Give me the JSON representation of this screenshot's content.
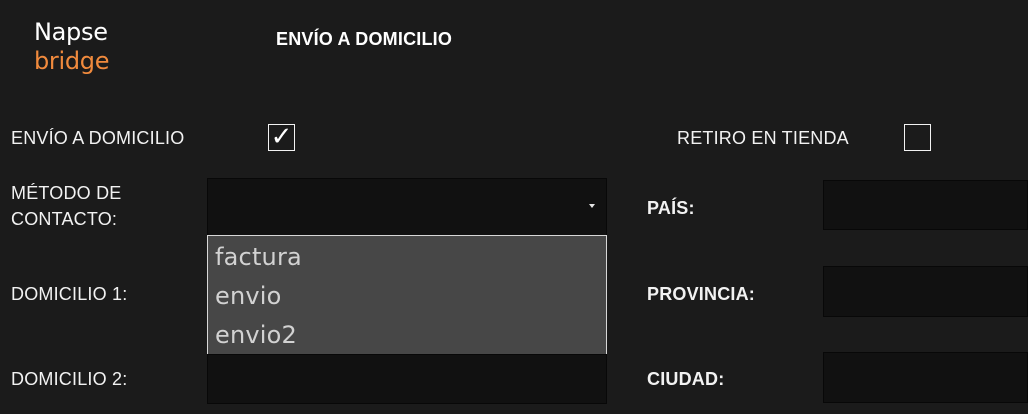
{
  "logo": {
    "line1": "Napse",
    "line2": "bridge"
  },
  "header": {
    "title": "ENVÍO A DOMICILIO"
  },
  "form": {
    "envio_domicilio": {
      "label": "ENVÍO A DOMICILIO",
      "checked": true,
      "mark": "✓"
    },
    "retiro_tienda": {
      "label": "RETIRO EN TIENDA",
      "checked": false
    },
    "metodo_contacto": {
      "label_line1": "MÉTODO DE",
      "label_line2": "CONTACTO:",
      "value": "",
      "options": [
        "factura",
        "envio",
        "envio2"
      ]
    },
    "domicilio1": {
      "label": "DOMICILIO 1:",
      "value": ""
    },
    "domicilio2": {
      "label": "DOMICILIO 2:",
      "value": ""
    },
    "pais": {
      "label": "PAÍS:",
      "value": ""
    },
    "provincia": {
      "label": "PROVINCIA:",
      "value": ""
    },
    "ciudad": {
      "label": "CIUDAD:",
      "value": ""
    }
  },
  "colors": {
    "background": "#1b1b1b",
    "field": "#111111",
    "dropdown": "#474747",
    "accent_logo": "#f08a3d"
  }
}
